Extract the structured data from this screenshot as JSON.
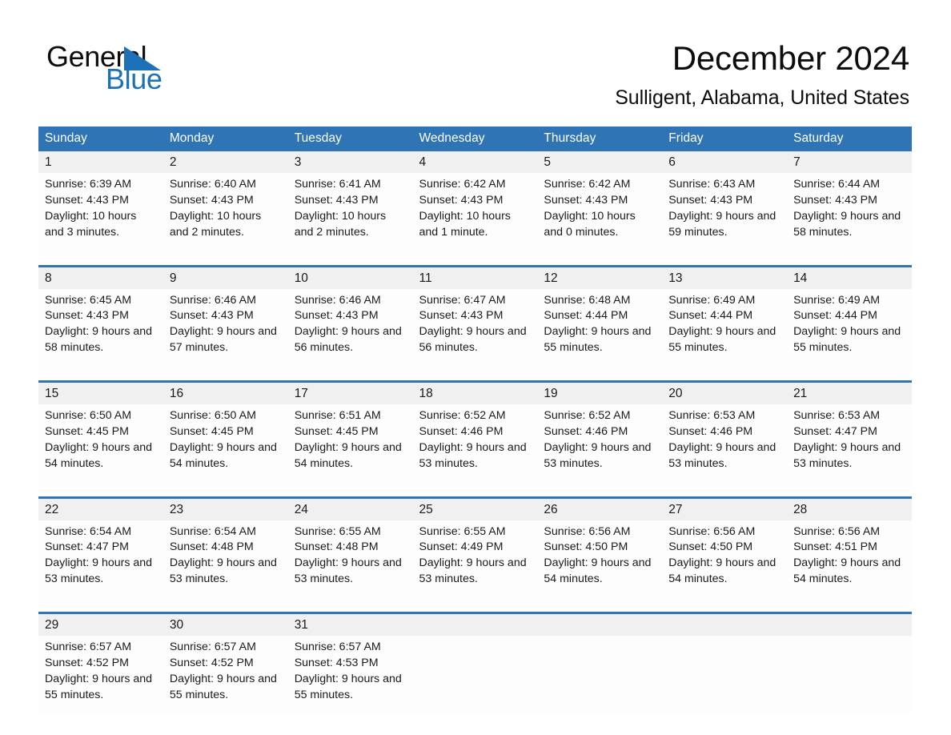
{
  "brand": {
    "name_part1": "General",
    "name_part2": "Blue",
    "accent_color": "#1d71b8",
    "header_color": "#2f74b5"
  },
  "header": {
    "title": "December 2024",
    "subtitle": "Sulligent, Alabama, United States"
  },
  "weekdays": [
    "Sunday",
    "Monday",
    "Tuesday",
    "Wednesday",
    "Thursday",
    "Friday",
    "Saturday"
  ],
  "weeks": [
    {
      "days": [
        {
          "num": "1",
          "sunrise": "Sunrise: 6:39 AM",
          "sunset": "Sunset: 4:43 PM",
          "daylight": "Daylight: 10 hours and 3 minutes."
        },
        {
          "num": "2",
          "sunrise": "Sunrise: 6:40 AM",
          "sunset": "Sunset: 4:43 PM",
          "daylight": "Daylight: 10 hours and 2 minutes."
        },
        {
          "num": "3",
          "sunrise": "Sunrise: 6:41 AM",
          "sunset": "Sunset: 4:43 PM",
          "daylight": "Daylight: 10 hours and 2 minutes."
        },
        {
          "num": "4",
          "sunrise": "Sunrise: 6:42 AM",
          "sunset": "Sunset: 4:43 PM",
          "daylight": "Daylight: 10 hours and 1 minute."
        },
        {
          "num": "5",
          "sunrise": "Sunrise: 6:42 AM",
          "sunset": "Sunset: 4:43 PM",
          "daylight": "Daylight: 10 hours and 0 minutes."
        },
        {
          "num": "6",
          "sunrise": "Sunrise: 6:43 AM",
          "sunset": "Sunset: 4:43 PM",
          "daylight": "Daylight: 9 hours and 59 minutes."
        },
        {
          "num": "7",
          "sunrise": "Sunrise: 6:44 AM",
          "sunset": "Sunset: 4:43 PM",
          "daylight": "Daylight: 9 hours and 58 minutes."
        }
      ]
    },
    {
      "days": [
        {
          "num": "8",
          "sunrise": "Sunrise: 6:45 AM",
          "sunset": "Sunset: 4:43 PM",
          "daylight": "Daylight: 9 hours and 58 minutes."
        },
        {
          "num": "9",
          "sunrise": "Sunrise: 6:46 AM",
          "sunset": "Sunset: 4:43 PM",
          "daylight": "Daylight: 9 hours and 57 minutes."
        },
        {
          "num": "10",
          "sunrise": "Sunrise: 6:46 AM",
          "sunset": "Sunset: 4:43 PM",
          "daylight": "Daylight: 9 hours and 56 minutes."
        },
        {
          "num": "11",
          "sunrise": "Sunrise: 6:47 AM",
          "sunset": "Sunset: 4:43 PM",
          "daylight": "Daylight: 9 hours and 56 minutes."
        },
        {
          "num": "12",
          "sunrise": "Sunrise: 6:48 AM",
          "sunset": "Sunset: 4:44 PM",
          "daylight": "Daylight: 9 hours and 55 minutes."
        },
        {
          "num": "13",
          "sunrise": "Sunrise: 6:49 AM",
          "sunset": "Sunset: 4:44 PM",
          "daylight": "Daylight: 9 hours and 55 minutes."
        },
        {
          "num": "14",
          "sunrise": "Sunrise: 6:49 AM",
          "sunset": "Sunset: 4:44 PM",
          "daylight": "Daylight: 9 hours and 55 minutes."
        }
      ]
    },
    {
      "days": [
        {
          "num": "15",
          "sunrise": "Sunrise: 6:50 AM",
          "sunset": "Sunset: 4:45 PM",
          "daylight": "Daylight: 9 hours and 54 minutes."
        },
        {
          "num": "16",
          "sunrise": "Sunrise: 6:50 AM",
          "sunset": "Sunset: 4:45 PM",
          "daylight": "Daylight: 9 hours and 54 minutes."
        },
        {
          "num": "17",
          "sunrise": "Sunrise: 6:51 AM",
          "sunset": "Sunset: 4:45 PM",
          "daylight": "Daylight: 9 hours and 54 minutes."
        },
        {
          "num": "18",
          "sunrise": "Sunrise: 6:52 AM",
          "sunset": "Sunset: 4:46 PM",
          "daylight": "Daylight: 9 hours and 53 minutes."
        },
        {
          "num": "19",
          "sunrise": "Sunrise: 6:52 AM",
          "sunset": "Sunset: 4:46 PM",
          "daylight": "Daylight: 9 hours and 53 minutes."
        },
        {
          "num": "20",
          "sunrise": "Sunrise: 6:53 AM",
          "sunset": "Sunset: 4:46 PM",
          "daylight": "Daylight: 9 hours and 53 minutes."
        },
        {
          "num": "21",
          "sunrise": "Sunrise: 6:53 AM",
          "sunset": "Sunset: 4:47 PM",
          "daylight": "Daylight: 9 hours and 53 minutes."
        }
      ]
    },
    {
      "days": [
        {
          "num": "22",
          "sunrise": "Sunrise: 6:54 AM",
          "sunset": "Sunset: 4:47 PM",
          "daylight": "Daylight: 9 hours and 53 minutes."
        },
        {
          "num": "23",
          "sunrise": "Sunrise: 6:54 AM",
          "sunset": "Sunset: 4:48 PM",
          "daylight": "Daylight: 9 hours and 53 minutes."
        },
        {
          "num": "24",
          "sunrise": "Sunrise: 6:55 AM",
          "sunset": "Sunset: 4:48 PM",
          "daylight": "Daylight: 9 hours and 53 minutes."
        },
        {
          "num": "25",
          "sunrise": "Sunrise: 6:55 AM",
          "sunset": "Sunset: 4:49 PM",
          "daylight": "Daylight: 9 hours and 53 minutes."
        },
        {
          "num": "26",
          "sunrise": "Sunrise: 6:56 AM",
          "sunset": "Sunset: 4:50 PM",
          "daylight": "Daylight: 9 hours and 54 minutes."
        },
        {
          "num": "27",
          "sunrise": "Sunrise: 6:56 AM",
          "sunset": "Sunset: 4:50 PM",
          "daylight": "Daylight: 9 hours and 54 minutes."
        },
        {
          "num": "28",
          "sunrise": "Sunrise: 6:56 AM",
          "sunset": "Sunset: 4:51 PM",
          "daylight": "Daylight: 9 hours and 54 minutes."
        }
      ]
    },
    {
      "days": [
        {
          "num": "29",
          "sunrise": "Sunrise: 6:57 AM",
          "sunset": "Sunset: 4:52 PM",
          "daylight": "Daylight: 9 hours and 55 minutes."
        },
        {
          "num": "30",
          "sunrise": "Sunrise: 6:57 AM",
          "sunset": "Sunset: 4:52 PM",
          "daylight": "Daylight: 9 hours and 55 minutes."
        },
        {
          "num": "31",
          "sunrise": "Sunrise: 6:57 AM",
          "sunset": "Sunset: 4:53 PM",
          "daylight": "Daylight: 9 hours and 55 minutes."
        },
        {
          "num": "",
          "sunrise": "",
          "sunset": "",
          "daylight": ""
        },
        {
          "num": "",
          "sunrise": "",
          "sunset": "",
          "daylight": ""
        },
        {
          "num": "",
          "sunrise": "",
          "sunset": "",
          "daylight": ""
        },
        {
          "num": "",
          "sunrise": "",
          "sunset": "",
          "daylight": ""
        }
      ]
    }
  ]
}
